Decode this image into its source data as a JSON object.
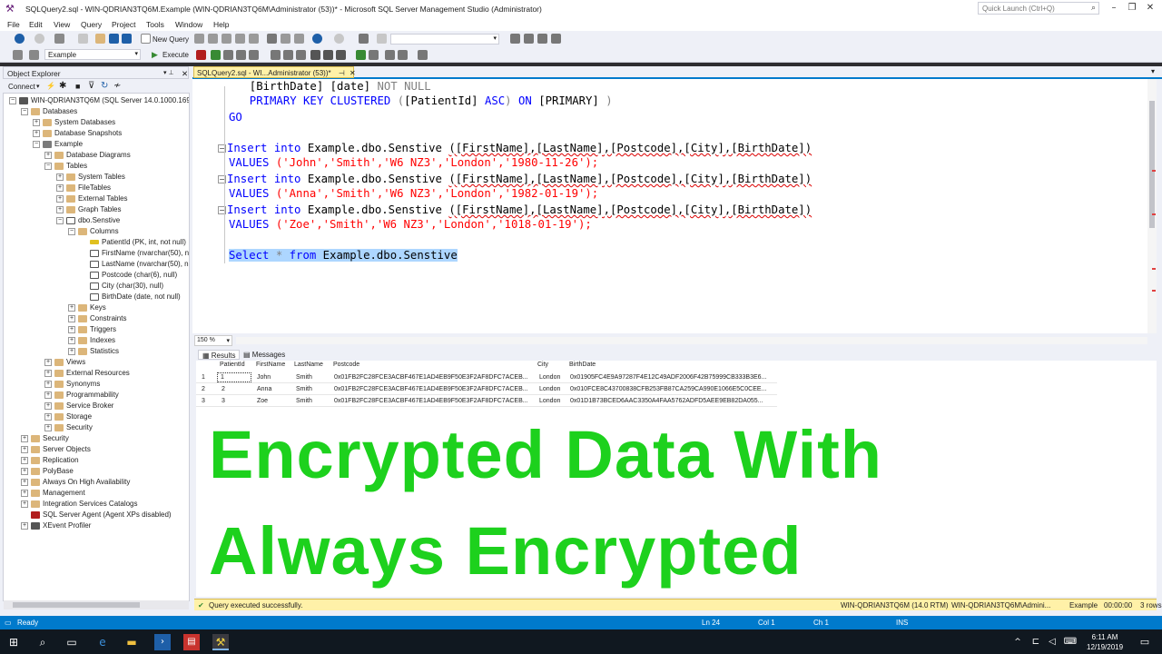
{
  "window": {
    "title": "SQLQuery2.sql - WIN-QDRIAN3TQ6M.Example (WIN-QDRIAN3TQ6M\\Administrator (53))* - Microsoft SQL Server Management Studio (Administrator)",
    "quick_launch_placeholder": "Quick Launch (Ctrl+Q)"
  },
  "menu": [
    "File",
    "Edit",
    "View",
    "Query",
    "Project",
    "Tools",
    "Window",
    "Help"
  ],
  "toolbar": {
    "new_query": "New Query",
    "database_combo": "Example",
    "execute": "Execute"
  },
  "object_explorer": {
    "title": "Object Explorer",
    "connect": "Connect",
    "nodes": [
      {
        "label": "WIN-QDRIAN3TQ6M (SQL Server 14.0.1000.169 - W",
        "depth": 0,
        "exp": "-",
        "icon": "srv"
      },
      {
        "label": "Databases",
        "depth": 1,
        "exp": "-",
        "icon": "folder"
      },
      {
        "label": "System Databases",
        "depth": 2,
        "exp": "+",
        "icon": "folder"
      },
      {
        "label": "Database Snapshots",
        "depth": 2,
        "exp": "+",
        "icon": "folder"
      },
      {
        "label": "Example",
        "depth": 2,
        "exp": "-",
        "icon": "db"
      },
      {
        "label": "Database Diagrams",
        "depth": 3,
        "exp": "+",
        "icon": "folder"
      },
      {
        "label": "Tables",
        "depth": 3,
        "exp": "-",
        "icon": "folder"
      },
      {
        "label": "System Tables",
        "depth": 4,
        "exp": "+",
        "icon": "folder"
      },
      {
        "label": "FileTables",
        "depth": 4,
        "exp": "+",
        "icon": "folder"
      },
      {
        "label": "External Tables",
        "depth": 4,
        "exp": "+",
        "icon": "folder"
      },
      {
        "label": "Graph Tables",
        "depth": 4,
        "exp": "+",
        "icon": "folder"
      },
      {
        "label": "dbo.Senstive",
        "depth": 4,
        "exp": "-",
        "icon": "tbl"
      },
      {
        "label": "Columns",
        "depth": 5,
        "exp": "-",
        "icon": "folder"
      },
      {
        "label": "PatientId (PK, int, not null)",
        "depth": 6,
        "exp": "",
        "icon": "key"
      },
      {
        "label": "FirstName (nvarchar(50), nu",
        "depth": 6,
        "exp": "",
        "icon": "col"
      },
      {
        "label": "LastName (nvarchar(50), nu",
        "depth": 6,
        "exp": "",
        "icon": "col"
      },
      {
        "label": "Postcode (char(6), null)",
        "depth": 6,
        "exp": "",
        "icon": "col"
      },
      {
        "label": "City (char(30), null)",
        "depth": 6,
        "exp": "",
        "icon": "col"
      },
      {
        "label": "BirthDate (date, not null)",
        "depth": 6,
        "exp": "",
        "icon": "col"
      },
      {
        "label": "Keys",
        "depth": 5,
        "exp": "+",
        "icon": "folder"
      },
      {
        "label": "Constraints",
        "depth": 5,
        "exp": "+",
        "icon": "folder"
      },
      {
        "label": "Triggers",
        "depth": 5,
        "exp": "+",
        "icon": "folder"
      },
      {
        "label": "Indexes",
        "depth": 5,
        "exp": "+",
        "icon": "folder"
      },
      {
        "label": "Statistics",
        "depth": 5,
        "exp": "+",
        "icon": "folder"
      },
      {
        "label": "Views",
        "depth": 3,
        "exp": "+",
        "icon": "folder"
      },
      {
        "label": "External Resources",
        "depth": 3,
        "exp": "+",
        "icon": "folder"
      },
      {
        "label": "Synonyms",
        "depth": 3,
        "exp": "+",
        "icon": "folder"
      },
      {
        "label": "Programmability",
        "depth": 3,
        "exp": "+",
        "icon": "folder"
      },
      {
        "label": "Service Broker",
        "depth": 3,
        "exp": "+",
        "icon": "folder"
      },
      {
        "label": "Storage",
        "depth": 3,
        "exp": "+",
        "icon": "folder"
      },
      {
        "label": "Security",
        "depth": 3,
        "exp": "+",
        "icon": "folder"
      },
      {
        "label": "Security",
        "depth": 1,
        "exp": "+",
        "icon": "folder"
      },
      {
        "label": "Server Objects",
        "depth": 1,
        "exp": "+",
        "icon": "folder"
      },
      {
        "label": "Replication",
        "depth": 1,
        "exp": "+",
        "icon": "folder"
      },
      {
        "label": "PolyBase",
        "depth": 1,
        "exp": "+",
        "icon": "folder"
      },
      {
        "label": "Always On High Availability",
        "depth": 1,
        "exp": "+",
        "icon": "folder"
      },
      {
        "label": "Management",
        "depth": 1,
        "exp": "+",
        "icon": "folder"
      },
      {
        "label": "Integration Services Catalogs",
        "depth": 1,
        "exp": "+",
        "icon": "folder"
      },
      {
        "label": "SQL Server Agent (Agent XPs disabled)",
        "depth": 1,
        "exp": "",
        "icon": "agent"
      },
      {
        "label": "XEvent Profiler",
        "depth": 1,
        "exp": "+",
        "icon": "xe"
      }
    ]
  },
  "editor": {
    "tab_label": "SQLQuery2.sql - WI...Administrator (53))*",
    "line1": {
      "a": "  [BirthDate] [date] ",
      "b": "NOT NULL"
    },
    "line2": {
      "a": "  PRIMARY KEY CLUSTERED ",
      "b": "(",
      "c": "[PatientId] ",
      "d": "ASC",
      "e": ") ",
      "f": "ON ",
      "g": "[PRIMARY]",
      "h": " )"
    },
    "line3": "GO",
    "insert_kw": "Insert into",
    "insert_target": " Example.dbo.Senstive ",
    "insert_cols": "([FirstName],[LastName],[Postcode],[City],[BirthDate])",
    "values_kw": "VALUES",
    "values": [
      "('John','Smith','W6 NZ3','London','1980-11-26');",
      "('Anna','Smith','W6 NZ3','London','1982-01-19');",
      "('Zoe','Smith','W6 NZ3','London','1018-01-19');"
    ],
    "select_kw": "Select",
    "select_star": " * ",
    "from_kw": "from",
    "select_target": " Example.dbo.Senstive",
    "zoom": "150 %"
  },
  "results": {
    "tabs": [
      "Results",
      "Messages"
    ],
    "columns": [
      "PatientId",
      "FirstName",
      "LastName",
      "Postcode",
      "City",
      "BirthDate"
    ],
    "rows": [
      {
        "n": "1",
        "PatientId": "1",
        "FirstName": "John",
        "LastName": "Smith",
        "Postcode": "0x01FB2FC28FCE3ACBF467E1AD4EB9F50E3F2AF8DFC7ACEB...",
        "City": "London",
        "BirthDate": "0x01905FC4E9A97287F4E12C49ADF2006F42B75999CB333B3E6..."
      },
      {
        "n": "2",
        "PatientId": "2",
        "FirstName": "Anna",
        "LastName": "Smith",
        "Postcode": "0x01FB2FC28FCE3ACBF467E1AD4EB9F50E3F2AF8DFC7ACEB...",
        "City": "London",
        "BirthDate": "0x010FCE8C43700838CFB253FB87CA259CA990E1066E5C0CEE..."
      },
      {
        "n": "3",
        "PatientId": "3",
        "FirstName": "Zoe",
        "LastName": "Smith",
        "Postcode": "0x01FB2FC28FCE3ACBF467E1AD4EB9F50E3F2AF8DFC7ACEB...",
        "City": "London",
        "BirthDate": "0x01D1B73BCED6AAC3350A4FAA5762ADFD5AEE9EB82DA055..."
      }
    ]
  },
  "overlay": {
    "line1": "Encrypted Data With",
    "line2": "Always Encrypted",
    "color": "#1dd11d"
  },
  "query_status": {
    "message": "Query executed successfully.",
    "server": "WIN-QDRIAN3TQ6M (14.0 RTM)",
    "user": "WIN-QDRIAN3TQ6M\\Admini...",
    "database": "Example",
    "elapsed": "00:00:00",
    "rows": "3 rows"
  },
  "statusbar": {
    "ready": "Ready",
    "ln": "Ln 24",
    "col": "Col 1",
    "ch": "Ch 1",
    "ins": "INS",
    "accent": "#007acc"
  },
  "taskbar": {
    "time": "6:11 AM",
    "date": "12/19/2019"
  }
}
